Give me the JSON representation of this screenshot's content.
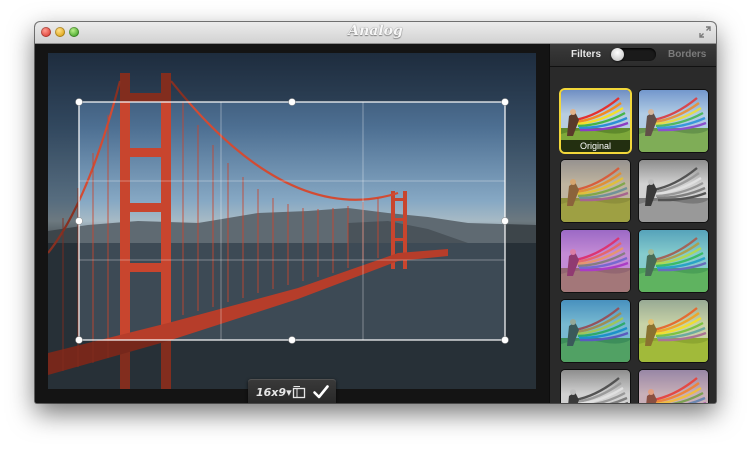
{
  "window": {
    "title": "Analog"
  },
  "crop_bar": {
    "ratio_label": "16x9",
    "ratio_caret": "▾"
  },
  "sidebar": {
    "tab_filters": "Filters",
    "tab_borders": "Borders",
    "active_tab": "Filters"
  },
  "filters": [
    {
      "label": "Original",
      "selected": true,
      "tint": "rgba(0,0,0,0)"
    },
    {
      "label": "",
      "selected": false,
      "tint": "rgba(140,200,255,0.15)"
    },
    {
      "label": "",
      "selected": false,
      "tint": "rgba(200,150,80,0.45)"
    },
    {
      "label": "",
      "selected": false,
      "tint": "grayscale"
    },
    {
      "label": "",
      "selected": false,
      "tint": "rgba(210,60,200,0.45)"
    },
    {
      "label": "",
      "selected": false,
      "tint": "rgba(40,200,170,0.35)"
    },
    {
      "label": "",
      "selected": false,
      "tint": "rgba(0,150,180,0.35)"
    },
    {
      "label": "",
      "selected": false,
      "tint": "rgba(230,220,60,0.35)"
    },
    {
      "label": "",
      "selected": false,
      "tint": "grayscale"
    },
    {
      "label": "",
      "selected": false,
      "tint": "rgba(230,120,110,0.35)"
    }
  ],
  "colors": {
    "selected_outline": "#f2d73a",
    "bridge": "#c8452e",
    "sky_top": "#2f4560"
  },
  "icons": {
    "close": "close-icon",
    "minimize": "minimize-icon",
    "zoom": "zoom-icon",
    "fullscreen": "fullscreen-icon",
    "orientation": "orientation-icon",
    "confirm": "checkmark-icon"
  }
}
